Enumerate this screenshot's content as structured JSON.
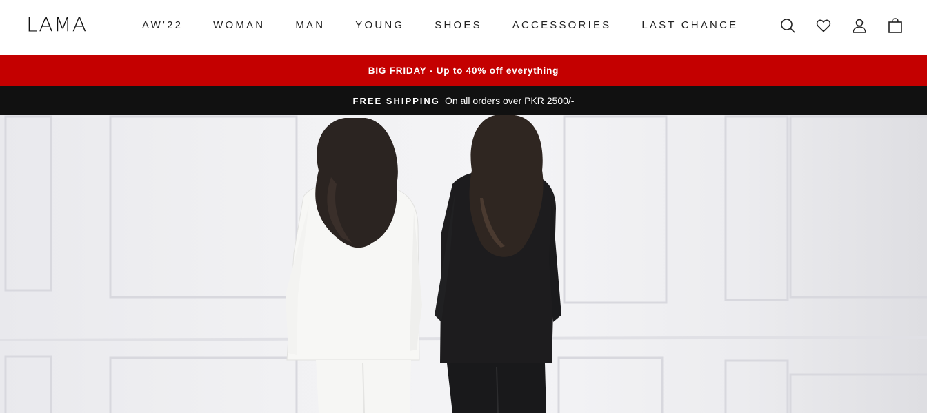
{
  "brand": {
    "logo_text": "LAMA"
  },
  "nav": {
    "items": [
      {
        "label": "AW'22"
      },
      {
        "label": "WOMAN"
      },
      {
        "label": "MAN"
      },
      {
        "label": "YOUNG"
      },
      {
        "label": "SHOES"
      },
      {
        "label": "ACCESSORIES"
      },
      {
        "label": "LAST CHANCE"
      }
    ]
  },
  "header_icons": [
    "search-icon",
    "heart-icon",
    "account-icon",
    "bag-icon"
  ],
  "promo": {
    "red_text": "BIG FRIDAY - Up to 40% off everything",
    "shipping_strong": "FREE SHIPPING",
    "shipping_rest": "On all orders over PKR 2500/-"
  },
  "colors": {
    "promo_red": "#c40000",
    "promo_black": "#111111"
  }
}
